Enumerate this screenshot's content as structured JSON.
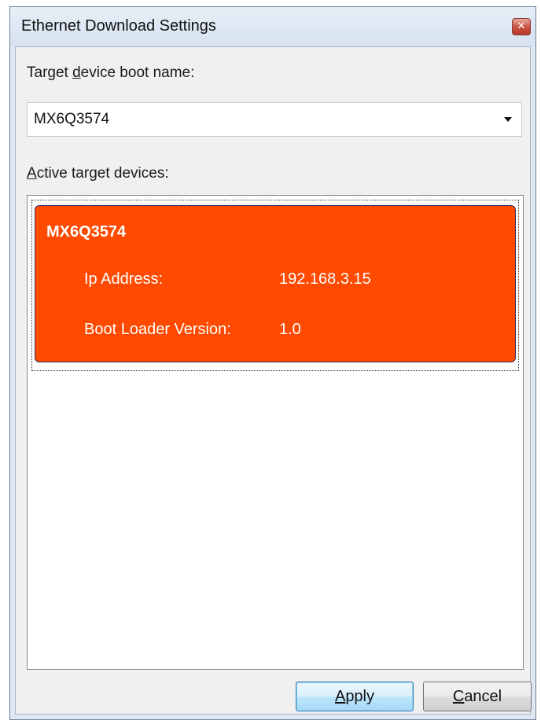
{
  "window": {
    "title": "Ethernet Download Settings",
    "close_icon": "close-icon"
  },
  "boot_name": {
    "label_pre": "Target ",
    "label_accel": "d",
    "label_post": "evice boot name:",
    "value": "MX6Q3574"
  },
  "active_devices": {
    "label_accel": "A",
    "label_post": "ctive target devices:",
    "items": [
      {
        "name": "MX6Q3574",
        "ip_label": "Ip Address:",
        "ip_value": "192.168.3.15",
        "version_label": "Boot Loader Version:",
        "version_value": "1.0",
        "color": "#ff4a00"
      }
    ]
  },
  "buttons": {
    "apply_accel": "A",
    "apply_post": "pply",
    "cancel_accel": "C",
    "cancel_post": "ancel"
  }
}
